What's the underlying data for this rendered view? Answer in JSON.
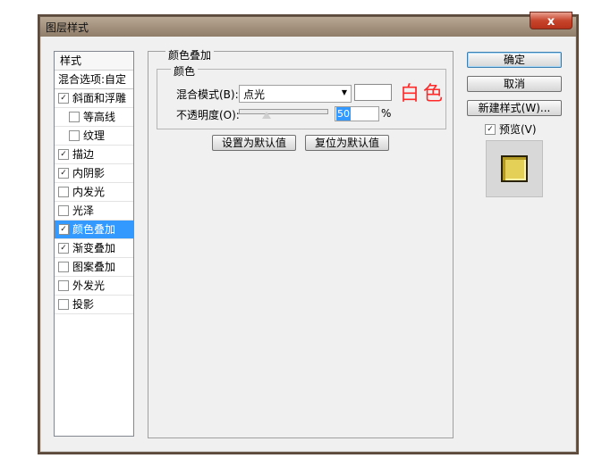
{
  "window": {
    "title": "图层样式",
    "close_label": "x"
  },
  "style_list": {
    "header": "样式",
    "blend_options": "混合选项:自定",
    "items": [
      {
        "label": "斜面和浮雕",
        "checked": true,
        "sub": false,
        "selected": false
      },
      {
        "label": "等高线",
        "checked": false,
        "sub": true,
        "selected": false
      },
      {
        "label": "纹理",
        "checked": false,
        "sub": true,
        "selected": false
      },
      {
        "label": "描边",
        "checked": true,
        "sub": false,
        "selected": false
      },
      {
        "label": "内阴影",
        "checked": true,
        "sub": false,
        "selected": false
      },
      {
        "label": "内发光",
        "checked": false,
        "sub": false,
        "selected": false
      },
      {
        "label": "光泽",
        "checked": false,
        "sub": false,
        "selected": false
      },
      {
        "label": "颜色叠加",
        "checked": true,
        "sub": false,
        "selected": true
      },
      {
        "label": "渐变叠加",
        "checked": true,
        "sub": false,
        "selected": false
      },
      {
        "label": "图案叠加",
        "checked": false,
        "sub": false,
        "selected": false
      },
      {
        "label": "外发光",
        "checked": false,
        "sub": false,
        "selected": false
      },
      {
        "label": "投影",
        "checked": false,
        "sub": false,
        "selected": false
      }
    ]
  },
  "panel": {
    "title": "颜色叠加",
    "group_title": "颜色",
    "blend_mode_label": "混合模式(B):",
    "blend_mode_value": "点光",
    "opacity_label": "不透明度(O):",
    "opacity_value": "50",
    "opacity_unit": "%",
    "annotation": "白色",
    "swatch_color": "#ffffff",
    "buttons": {
      "set_default": "设置为默认值",
      "reset_default": "复位为默认值"
    }
  },
  "actions": {
    "ok": "确定",
    "cancel": "取消",
    "new_style": "新建样式(W)...",
    "preview_label": "预览(V)",
    "preview_checked": true
  }
}
